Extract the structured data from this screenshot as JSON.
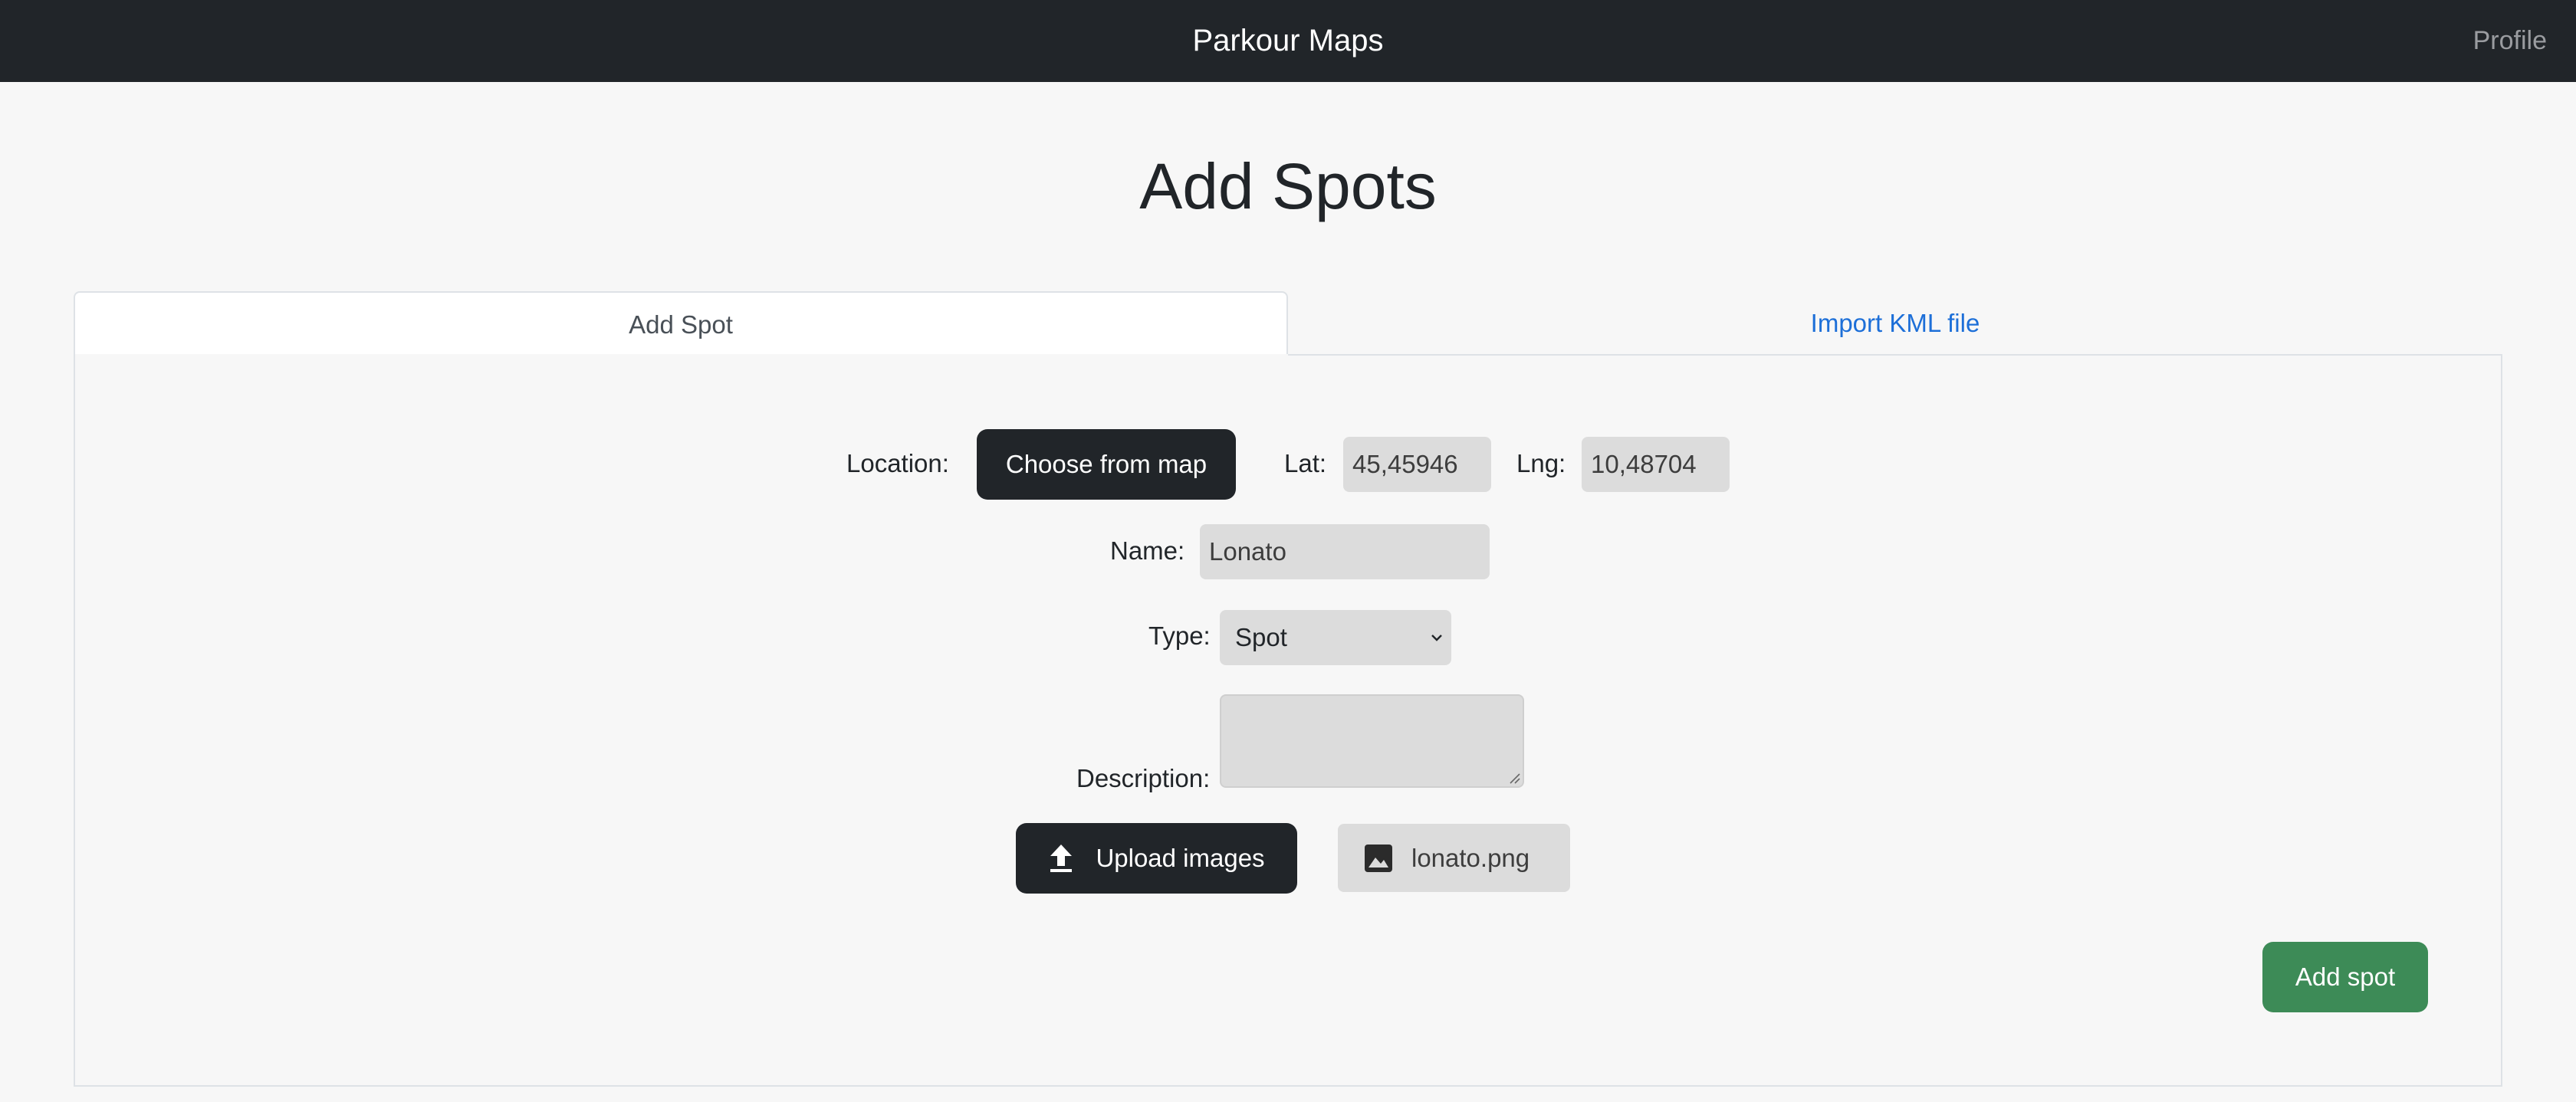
{
  "navbar": {
    "title": "Parkour Maps",
    "profile_link": "Profile"
  },
  "page": {
    "title": "Add Spots"
  },
  "tabs": [
    {
      "label": "Add Spot",
      "active": true
    },
    {
      "label": "Import KML file",
      "active": false
    }
  ],
  "form": {
    "location_label": "Location:",
    "choose_map_button": "Choose from map",
    "lat_label": "Lat:",
    "lat_value": "45,45946",
    "lng_label": "Lng:",
    "lng_value": "10,48704",
    "name_label": "Name:",
    "name_value": "Lonato",
    "type_label": "Type:",
    "type_selected": "Spot",
    "description_label": "Description:",
    "description_value": "",
    "upload_button": "Upload images",
    "uploaded_file": "lonato.png",
    "submit_button": "Add spot"
  },
  "icons": {
    "upload": "upload-icon",
    "image": "image-icon",
    "chevron": "chevron-down-icon"
  },
  "colors": {
    "navbar_bg": "#212529",
    "link": "#1d6fd8",
    "submit_bg": "#3d8b57",
    "dark_button": "#212529"
  }
}
